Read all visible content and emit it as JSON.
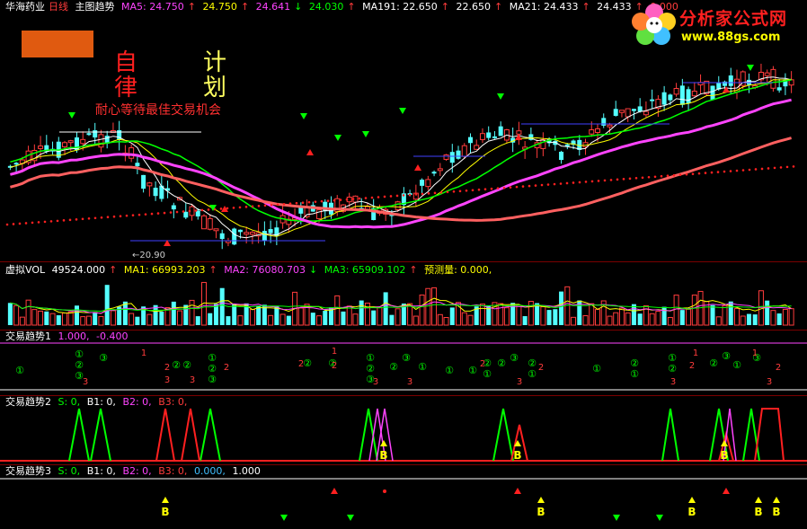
{
  "header": {
    "stock": "华海药业",
    "period": "日线",
    "indicator": "主图趋势",
    "ma5_label": "MA5: 24.750",
    "ma5_v2": "24.750",
    "ma5_v3": "24.641",
    "ma5_v4": "24.030",
    "ma191_label": "MA191: 22.650",
    "ma191_v2": "22.650",
    "ma21_label": "MA21: 24.433",
    "ma21_v2": "24.433",
    "ma21_v3": "0.000"
  },
  "logo": {
    "title": "分析家公式网",
    "url": "www.88gs.com"
  },
  "annotations": {
    "zi": "自",
    "lv": "律",
    "ji": "计",
    "hua": "划",
    "slogan": "耐心等待最佳交易机会",
    "low_label": "20.90"
  },
  "vol": {
    "title": "虚拟VOL",
    "value": "49524.000",
    "ma1": "MA1: 66993.203",
    "ma2": "MA2: 76080.703",
    "ma3": "MA3: 65909.102",
    "forecast": "预测量: 0.000,"
  },
  "trend1": {
    "title": "交易趋势1",
    "v1": "1.000,",
    "v2": "-0.400"
  },
  "trend2": {
    "title": "交易趋势2",
    "s": "S: 0,",
    "b1": "B1: 0,",
    "b2": "B2: 0,",
    "b3": "B3: 0,"
  },
  "trend3": {
    "title": "交易趋势3",
    "s": "S: 0,",
    "b1": "B1: 0,",
    "b2": "B2: 0,",
    "b3": "B3: 0,",
    "v5": "0.000,",
    "v6": "1.000"
  },
  "signals": {
    "buy": "B"
  },
  "colors": {
    "up": "#ff3c3c",
    "down": "#54ffff",
    "ma_white": "#ffffff",
    "ma_yellow": "#ffff00",
    "ma_magenta": "#ff44ff",
    "ma_green": "#00ff00",
    "ma_orange": "#ff6060",
    "accent_blue": "#4040ff"
  },
  "chart_data": {
    "type": "candlestick",
    "title": "",
    "n_bars": 130,
    "ma5_last": 24.75,
    "ma21_last": 24.433,
    "ma191_last": 22.65,
    "low_marked": 20.9
  }
}
